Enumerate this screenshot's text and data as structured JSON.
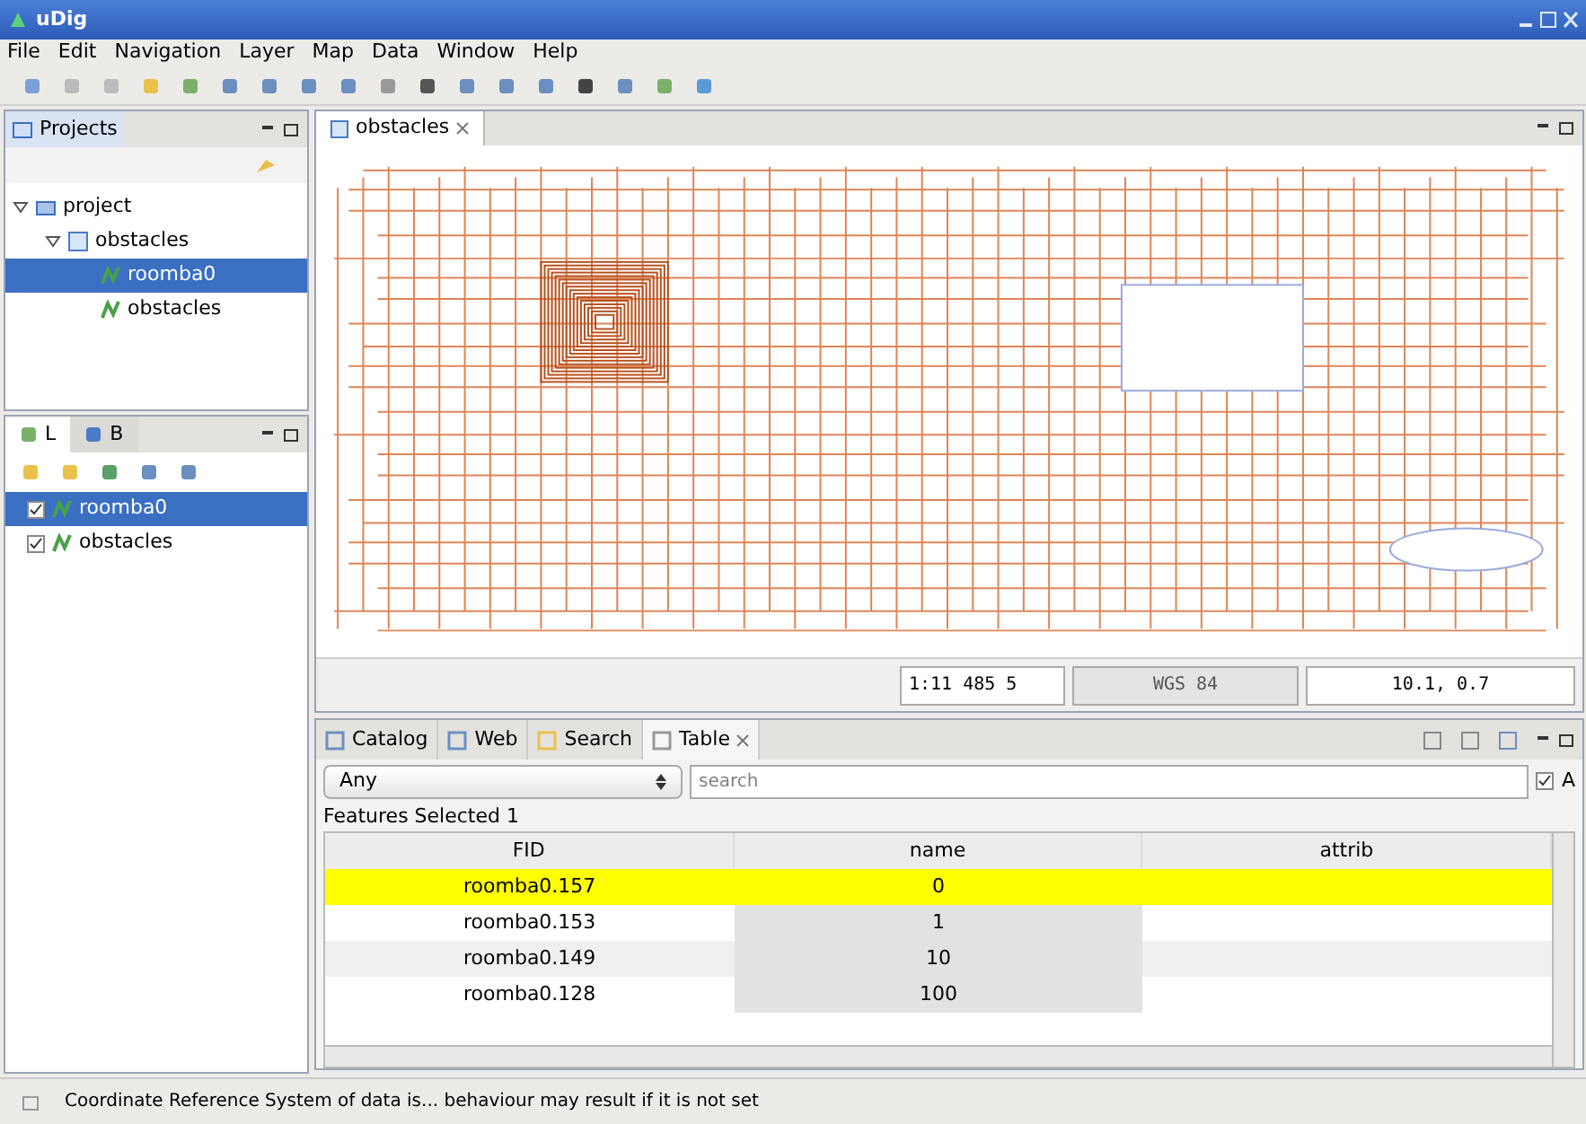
{
  "window": {
    "title": "uDig"
  },
  "menu": [
    "File",
    "Edit",
    "Navigation",
    "Layer",
    "Map",
    "Data",
    "Window",
    "Help"
  ],
  "projects_view": {
    "title": "Projects",
    "tree": [
      {
        "label": "project",
        "kind": "project",
        "expanded": true,
        "selected": false,
        "children": [
          {
            "label": "obstacles",
            "kind": "map",
            "expanded": true,
            "selected": false,
            "children": [
              {
                "label": "roomba0",
                "kind": "layer",
                "selected": true
              },
              {
                "label": "obstacles",
                "kind": "layer",
                "selected": false
              }
            ]
          }
        ]
      }
    ]
  },
  "layers_view": {
    "tabs": [
      {
        "label": "L",
        "selected": true
      },
      {
        "label": "B",
        "selected": false
      }
    ],
    "layers": [
      {
        "label": "roomba0",
        "checked": true,
        "selected": true
      },
      {
        "label": "obstacles",
        "checked": true,
        "selected": false
      }
    ]
  },
  "editor": {
    "tab": "obstacles",
    "status": {
      "scale": "1:11 485 5",
      "crs": "WGS 84",
      "coordinates": "10.1, 0.7"
    }
  },
  "bottom_tabs": [
    {
      "label": "Catalog",
      "selected": false
    },
    {
      "label": "Web",
      "selected": false
    },
    {
      "label": "Search",
      "selected": false
    },
    {
      "label": "Table",
      "selected": true
    }
  ],
  "filter": {
    "attribute": "Any",
    "placeholder": "search",
    "toggle_label": "A",
    "toggle_checked": true
  },
  "features_selected": "Features Selected 1",
  "table": {
    "columns": [
      "FID",
      "name",
      "attrib"
    ],
    "rows": [
      {
        "cells": [
          "roomba0.157",
          "0",
          ""
        ],
        "selected": true
      },
      {
        "cells": [
          "roomba0.153",
          "1",
          ""
        ],
        "selected": false
      },
      {
        "cells": [
          "roomba0.149",
          "10",
          ""
        ],
        "selected": false
      },
      {
        "cells": [
          "roomba0.128",
          "100",
          ""
        ],
        "selected": false
      }
    ]
  },
  "status_bar": "Coordinate Reference System of data is... behaviour may result if it is not set"
}
